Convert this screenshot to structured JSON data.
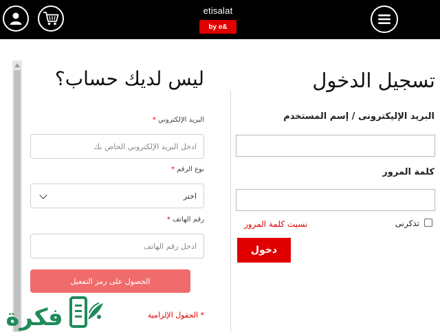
{
  "header": {
    "brand_name": "etisalat",
    "brand_badge": "by e&",
    "icons": [
      "user-icon",
      "cart-icon",
      "menu-icon"
    ]
  },
  "login": {
    "title": "تسجيل الدخول",
    "username_label": "البريد الإليكترونى / إسم المستخدم",
    "username_value": "",
    "password_label": "كلمة المرور",
    "password_value": "",
    "remember_label": "تذكرنى",
    "remember_checked": false,
    "forgot_link": "نسيت كلمة المرور",
    "submit_label": "دخول"
  },
  "register": {
    "title": "ليس لديك حساب؟",
    "email_label": "البريد الإلكتروني",
    "email_placeholder": "ادخل البريد الإلكتروني الخاص بك",
    "number_type_label": "نوع الرقم",
    "number_type_selected": "اختر",
    "phone_label": "رقم الهاتف",
    "phone_placeholder": "ادخل رقم الهاتف",
    "required_marker": "*",
    "activation_button": "الحصول على رمز التفعيل",
    "required_note": "* الحقول الإلزامية"
  },
  "watermark": {
    "text": "فكرة"
  },
  "colors": {
    "accent": "#e00000",
    "accent_light": "#f06b6b",
    "header_bg": "#000000",
    "watermark_green": "#1f8a5a"
  }
}
